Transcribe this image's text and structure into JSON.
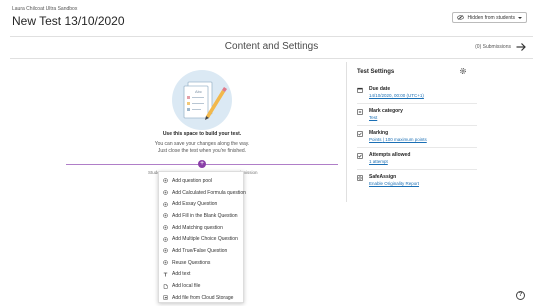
{
  "header": {
    "breadcrumb": "Laura Chilcoat Ultra Sandbox",
    "title": "New Test 13/10/2020",
    "visibility_label": "Hidden from students"
  },
  "content": {
    "section_title": "Content and Settings",
    "submissions": "(0) Submissions",
    "empty_title": "Use this space to build your test.",
    "empty_line1": "You can save your changes along the way.",
    "empty_line2": "Just close the test when you're finished.",
    "underlay_left": "Studer",
    "underlay_right": "nt submission"
  },
  "menu": {
    "items": [
      {
        "label": "Add question pool",
        "icon": "add-circle-icon"
      },
      {
        "label": "Add Calculated Formula question",
        "icon": "add-circle-icon"
      },
      {
        "label": "Add Essay Question",
        "icon": "add-circle-icon"
      },
      {
        "label": "Add Fill in the Blank Question",
        "icon": "add-circle-icon"
      },
      {
        "label": "Add Matching question",
        "icon": "add-circle-icon"
      },
      {
        "label": "Add Multiple Choice Question",
        "icon": "add-circle-icon"
      },
      {
        "label": "Add True/False Question",
        "icon": "add-circle-icon"
      },
      {
        "label": "Reuse Questions",
        "icon": "add-circle-icon"
      },
      {
        "label": "Add text",
        "icon": "text-icon"
      },
      {
        "label": "Add local file",
        "icon": "file-icon"
      },
      {
        "label": "Add file from Cloud Storage",
        "icon": "cloud-icon"
      }
    ]
  },
  "settings": {
    "heading": "Test Settings",
    "due_date_label": "Due date",
    "due_date_value": "14/10/2020, 00:00 (UTC+1)",
    "mark_category_label": "Mark category",
    "mark_category_value": "Test",
    "marking_label": "Marking",
    "marking_points": "Points",
    "marking_separator": "|",
    "marking_max": "100 maximum points",
    "attempts_label": "Attempts allowed",
    "attempts_value": "1 attempt",
    "safeassign_label": "SafeAssign",
    "safeassign_value": "Enable Originality Report"
  },
  "colors": {
    "accent": "#8a3fa8",
    "link": "#1a6fb5",
    "illustration_bg": "#dbe9f4"
  }
}
